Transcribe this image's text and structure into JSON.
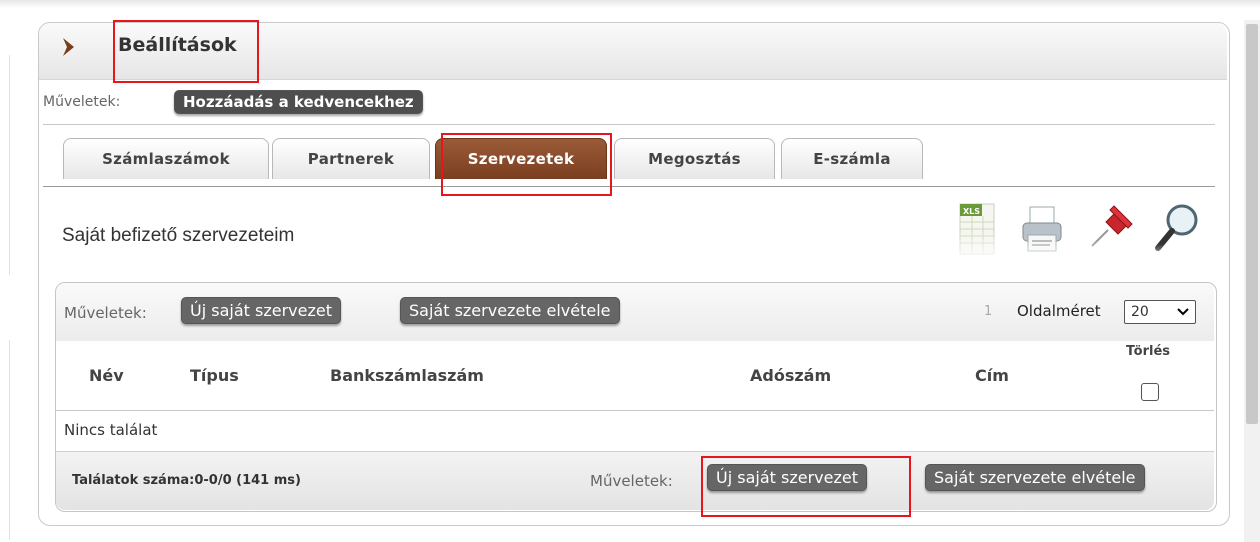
{
  "header": {
    "title": "Beállítások"
  },
  "top_ops": {
    "label": "Műveletek:",
    "favorite_button": "Hozzáadás a kedvencekhez"
  },
  "tabs": [
    {
      "label": "Számlaszámok",
      "active": false
    },
    {
      "label": "Partnerek",
      "active": false
    },
    {
      "label": "Szervezetek",
      "active": true
    },
    {
      "label": "Megosztás",
      "active": false
    },
    {
      "label": "E-számla",
      "active": false
    }
  ],
  "section": {
    "title": "Saját befizető szervezeteim"
  },
  "toolbar_icons": [
    "xls-export-icon",
    "print-icon",
    "pin-icon",
    "search-icon"
  ],
  "xls_badge": "XLS",
  "grid_top": {
    "ops_label": "Műveletek:",
    "new_button": "Új saját szervezet",
    "remove_button": "Saját szervezete elvétele",
    "page_number": "1",
    "page_size_label": "Oldalméret",
    "page_size_value": "20"
  },
  "columns": {
    "name": "Név",
    "type": "Típus",
    "bank": "Bankszámlaszám",
    "tax": "Adószám",
    "address": "Cím",
    "delete": "Törlés"
  },
  "empty_message": "Nincs találat",
  "grid_bottom": {
    "results": "Találatok száma:0-0/0 (141 ms)",
    "ops_label": "Műveletek:",
    "new_button": "Új saját szervezet",
    "remove_button": "Saját szervezete elvétele"
  },
  "colors": {
    "active_tab": "#8a4a2a",
    "highlight": "#e8141e",
    "button": "#666666"
  }
}
